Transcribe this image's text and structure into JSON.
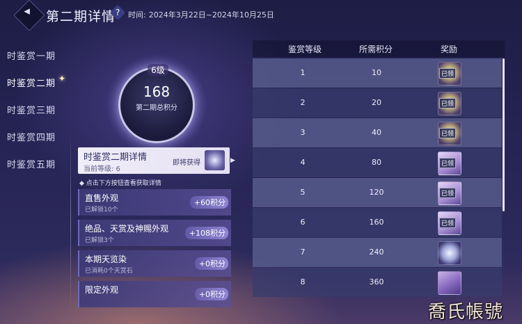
{
  "header": {
    "title": "第二期详情",
    "help_icon": "question-icon",
    "time_label": "时间:",
    "time_value": "2024年3月22日~2024年10月25日"
  },
  "nav": {
    "items": [
      {
        "label": "时鉴赏一期",
        "active": false
      },
      {
        "label": "时鉴赏二期",
        "active": true
      },
      {
        "label": "时鉴赏三期",
        "active": false
      },
      {
        "label": "时鉴赏四期",
        "active": false
      },
      {
        "label": "时鉴赏五期",
        "active": false
      }
    ]
  },
  "summary": {
    "level": "6级",
    "score": "168",
    "score_label": "第二期总积分"
  },
  "detail": {
    "title": "时鉴赏二期详情",
    "current_level": "当前等级: 6",
    "upcoming": "即将获得"
  },
  "hint": "◆ 点击下方按钮查看获取详情",
  "score_cards": [
    {
      "name": "直售外观",
      "sub": "已解锁10个",
      "badge": "+60积分"
    },
    {
      "name": "绝品、天赏及神赐外观",
      "sub": "已解锁3个",
      "badge": "+108积分"
    },
    {
      "name": "本期天览染",
      "sub": "已消耗0个天赏石",
      "badge": "+0积分"
    },
    {
      "name": "限定外观",
      "sub": "",
      "badge": "+0积分"
    }
  ],
  "table": {
    "headers": [
      "鉴赏等级",
      "所需积分",
      "奖励"
    ],
    "rows": [
      {
        "level": "1",
        "points": "10",
        "reward": "mirror",
        "claimed": "已领"
      },
      {
        "level": "2",
        "points": "20",
        "reward": "mirror",
        "claimed": "已领"
      },
      {
        "level": "3",
        "points": "40",
        "reward": "mirror",
        "claimed": "已领"
      },
      {
        "level": "4",
        "points": "80",
        "reward": "paper",
        "claimed": "已领"
      },
      {
        "level": "5",
        "points": "120",
        "reward": "paper",
        "claimed": "已领"
      },
      {
        "level": "6",
        "points": "160",
        "reward": "paper",
        "claimed": "已领"
      },
      {
        "level": "7",
        "points": "240",
        "reward": "figure",
        "claimed": ""
      },
      {
        "level": "8",
        "points": "360",
        "reward": "box",
        "claimed": ""
      }
    ]
  },
  "watermark": "喬氏帳號"
}
